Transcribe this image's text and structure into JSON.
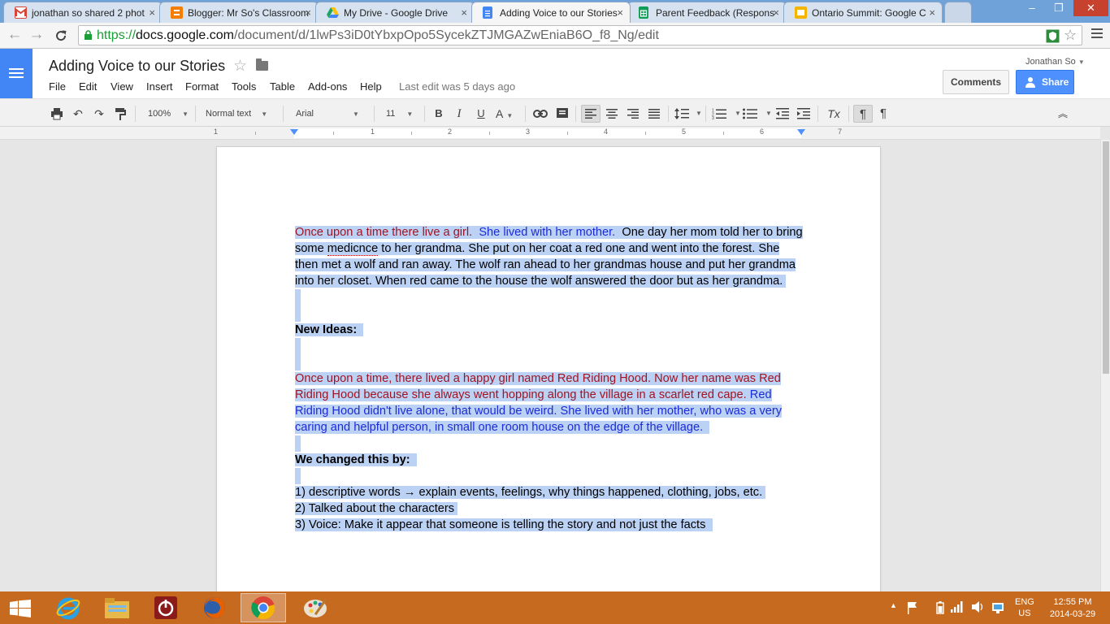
{
  "browser": {
    "tabs": [
      {
        "title": "jonathan so shared 2 phot",
        "icon": "gmail-icon",
        "color": "#d44638"
      },
      {
        "title": "Blogger: Mr So's Classroom",
        "icon": "blogger-icon",
        "color": "#f57d00"
      },
      {
        "title": "My Drive - Google Drive",
        "icon": "drive-icon",
        "color": "#1fa463"
      },
      {
        "title": "Adding Voice to our Stories",
        "icon": "docs-icon",
        "color": "#4285f4"
      },
      {
        "title": "Parent Feedback (Respons",
        "icon": "sheets-icon",
        "color": "#0f9d58"
      },
      {
        "title": "Ontario Summit: Google C",
        "icon": "slides-icon",
        "color": "#f4b400"
      }
    ],
    "url_scheme": "https://",
    "url_host": "docs.google.com",
    "url_path": "/document/d/1lwPs3iD0tYbxpOpo5SycekZTJMGAZwEniaB6O_f8_Ng/edit"
  },
  "doc": {
    "title": "Adding Voice to our Stories",
    "menus": [
      "File",
      "Edit",
      "View",
      "Insert",
      "Format",
      "Tools",
      "Table",
      "Add-ons",
      "Help"
    ],
    "last_edit": "Last edit was 5 days ago",
    "user": "Jonathan So",
    "comments_label": "Comments",
    "share_label": "Share"
  },
  "toolbar": {
    "zoom": "100%",
    "style": "Normal text",
    "font": "Arial",
    "size": "11",
    "bold": "B",
    "italic": "I",
    "underline": "U",
    "text_color": "A",
    "clear_format": "Tx"
  },
  "ruler": {
    "numbers": [
      "1",
      "1",
      "2",
      "3",
      "4",
      "5",
      "6",
      "7"
    ]
  },
  "content": {
    "p1_l1_red": "Once upon a time there live a girl.",
    "p1_l1_blue": "She lived with her mother.",
    "p1_l1_black": "One day her mom told her to bring",
    "p1_l2_a": "some",
    "p1_l2_misspelled": "medicnce",
    "p1_l2_b": "to her grandma.  She put on her coat a red one and went into the forest.  She",
    "p1_l3": "then met a wolf and ran away.  The wolf ran ahead to her grandmas house and put her grandma",
    "p1_l4": "into her closet. When red came to the house the wolf answered the door but as her grandma.",
    "heading_new_ideas": "New Ideas:",
    "p2_l1": "Once upon a time, there lived a happy girl named Red Riding Hood. Now her name was Red",
    "p2_l2_red": "Riding Hood because she always went hopping along the village in a scarlet red cape.",
    "p2_l2_blue": "Red",
    "p2_l3": "Riding Hood didn't live alone, that would be weird.  She lived with her mother, who was a very",
    "p2_l4": "caring and helpful person, in small one room house on the edge of the village.",
    "heading_changed": "We changed this by:",
    "list": [
      "1) descriptive words → explain events, feelings, why things happened, clothing, jobs, etc.",
      "2) Talked about the characters",
      "3) Voice: Make it appear that someone is telling the story and not just the facts"
    ]
  },
  "taskbar": {
    "apps": [
      "windows-start-icon",
      "internet-explorer-icon",
      "file-explorer-icon",
      "power-app-icon",
      "firefox-icon",
      "chrome-icon",
      "paint-icon"
    ],
    "language_1": "ENG",
    "language_2": "US",
    "time": "12:55 PM",
    "date": "2014-03-29"
  }
}
